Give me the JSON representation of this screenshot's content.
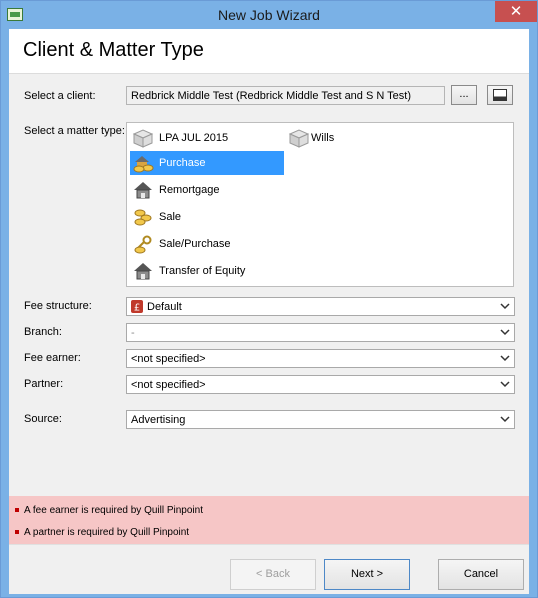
{
  "window": {
    "title": "New Job Wizard",
    "close_glyph": "✕"
  },
  "header": {
    "title": "Client & Matter Type"
  },
  "client": {
    "label": "Select a client:",
    "value": "Redbrick Middle Test (Redbrick Middle Test and S N Test)",
    "browse_label": "..."
  },
  "matter": {
    "label": "Select a matter type:",
    "items": [
      {
        "label": "LPA JUL 2015",
        "icon": "box-icon",
        "selected": false
      },
      {
        "label": "Wills",
        "icon": "box-icon",
        "selected": false
      },
      {
        "label": "Purchase",
        "icon": "house-coins-icon",
        "selected": true
      },
      {
        "label": "Remortgage",
        "icon": "house-icon",
        "selected": false
      },
      {
        "label": "Sale",
        "icon": "coins-icon",
        "selected": false
      },
      {
        "label": "Sale/Purchase",
        "icon": "key-coins-icon",
        "selected": false
      },
      {
        "label": "Transfer of Equity",
        "icon": "house-icon",
        "selected": false
      }
    ]
  },
  "fields": {
    "fee_structure": {
      "label": "Fee structure:",
      "value": "Default"
    },
    "branch": {
      "label": "Branch:",
      "value": "-"
    },
    "fee_earner": {
      "label": "Fee earner:",
      "value": "<not specified>"
    },
    "partner": {
      "label": "Partner:",
      "value": "<not specified>"
    },
    "source": {
      "label": "Source:",
      "value": "Advertising"
    }
  },
  "errors": [
    "A fee earner is required by Quill Pinpoint",
    "A partner is required by Quill Pinpoint"
  ],
  "buttons": {
    "back": "< Back",
    "next": "Next >",
    "cancel": "Cancel"
  },
  "colors": {
    "selection": "#3399ff",
    "error_bg": "#f6c6c6",
    "titlebar": "#7ab1e6",
    "close": "#c75050"
  }
}
